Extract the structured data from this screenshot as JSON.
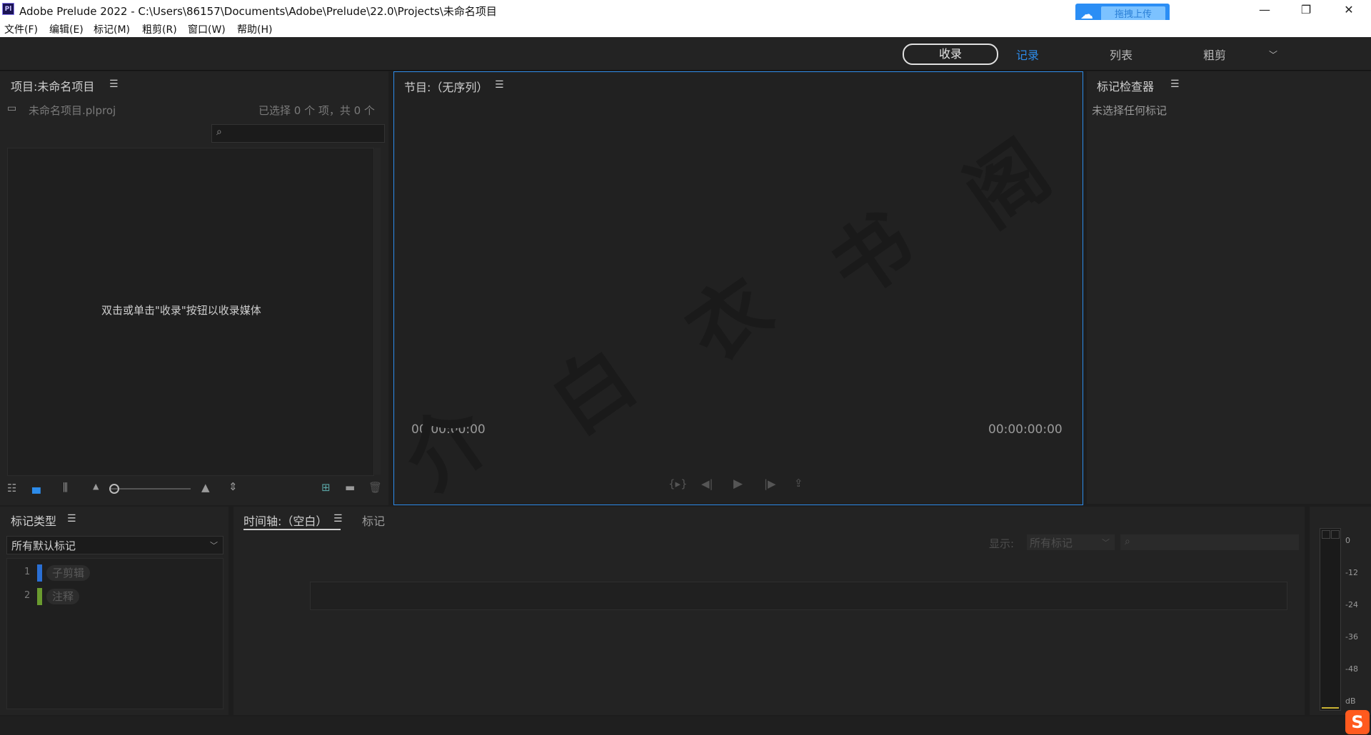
{
  "window": {
    "app_badge": "Pl",
    "title": "Adobe Prelude 2022 - C:\\Users\\86157\\Documents\\Adobe\\Prelude\\22.0\\Projects\\未命名项目",
    "minimize": "—",
    "restore": "❐",
    "close": "✕"
  },
  "upload_widget": {
    "label": "拖拽上传",
    "icon": "cloud-icon"
  },
  "menu": [
    "文件(F)",
    "编辑(E)",
    "标记(M)",
    "粗剪(R)",
    "窗口(W)",
    "帮助(H)"
  ],
  "workspaces": {
    "ingest": "收录",
    "log": "记录",
    "list": "列表",
    "rough_cut": "粗剪",
    "active": "记录",
    "accent": "#2d8ceb"
  },
  "project_panel": {
    "title": "项目:未命名项目",
    "file_name": "未命名项目.plproj",
    "selection_status": "已选择 0 个 项，共 0 个",
    "search_placeholder": "",
    "empty_message": "双击或单击\"收录\"按钮以收录媒体"
  },
  "program_panel": {
    "title": "节目:（无序列）",
    "timecode_left": "00:00:00:00",
    "timecode_right": "00:00:00:00",
    "border_color": "#2d8ceb"
  },
  "marker_inspector": {
    "title": "标记检查器",
    "empty_message": "未选择任何标记"
  },
  "marker_type_panel": {
    "title": "标记类型",
    "dropdown_value": "所有默认标记",
    "items": [
      {
        "index": "1",
        "label": "子剪辑",
        "color": "#2a6fd4"
      },
      {
        "index": "2",
        "label": "注释",
        "color": "#6a9b2f"
      }
    ]
  },
  "timeline_panel": {
    "tab_timeline": "时间轴:（空白）",
    "tab_markers": "标记",
    "show_label": "显示:",
    "show_value": "所有标记"
  },
  "audio_meter": {
    "labels": [
      "0",
      "-12",
      "-24",
      "-36",
      "-48",
      "dB"
    ]
  },
  "watermark": [
    "介",
    "白",
    "衣",
    "书",
    "阁"
  ]
}
